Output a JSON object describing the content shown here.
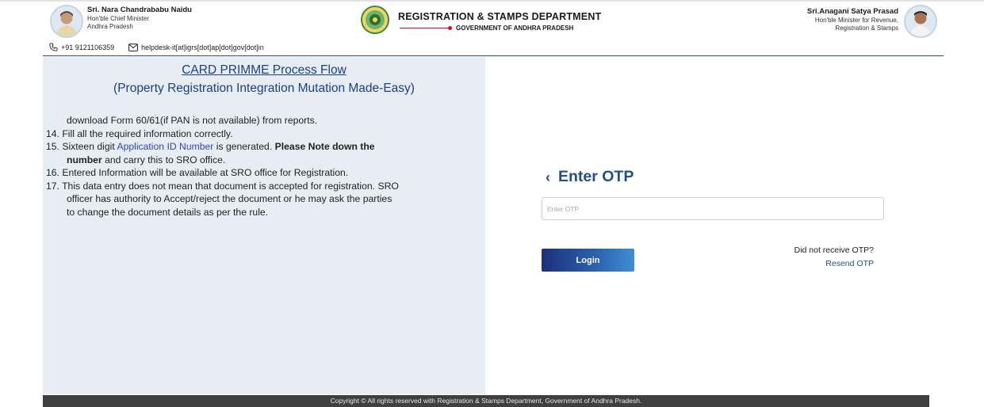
{
  "header": {
    "cm": {
      "name": "Sri. Nara Chandrababu Naidu",
      "title": "Hon'ble Chief Minister",
      "state": "Andhra Pradesh"
    },
    "department": {
      "title": "REGISTRATION & STAMPS DEPARTMENT",
      "government": "GOVERNMENT OF ANDHRA PRADESH"
    },
    "minister": {
      "name": "Sri.Anagani Satya Prasad",
      "title_line1": "Hon'ble Minister for Revenue,",
      "title_line2": "Registration & Stamps"
    },
    "contact": {
      "phone": "+91 9121106359",
      "email": "helpdesk-it[at]igrs[dot]ap[dot]gov[dot]in",
      "phone_icon": "phone-icon",
      "email_icon": "mail-icon"
    }
  },
  "process_flow": {
    "title": "CARD PRIMME Process Flow",
    "subtitle": "(Property Registration Integration Mutation Made-Easy)",
    "lines": {
      "l0": "download Form 60/61(if PAN is not available) from reports.",
      "l14": "14. Fill all the required information correctly.",
      "l15_pre": "15. Sixteen digit ",
      "l15_link": "Application ID Number",
      "l15_mid": " is generated. ",
      "l15_bold": "Please Note down the",
      "l15b_bold": "number",
      "l15b_rest": " and carry this to SRO office.",
      "l16": "16. Entered Information will be available at SRO office for Registration.",
      "l17a": "17. This data entry does not mean that document is accepted for registration. SRO",
      "l17b": "officer has authority to Accept/reject the document or he may ask the parties",
      "l17c": "to change the document details as per the rule."
    }
  },
  "otp": {
    "back_icon": "chevron-left-icon",
    "back_glyph": "‹",
    "title": "Enter OTP",
    "input_placeholder": "Enter OTP",
    "input_value": "",
    "login_label": "Login",
    "resend_question": "Did not receive OTP?",
    "resend_label": "Resend OTP"
  },
  "footer": {
    "text": "Copyright © All rights reserved with Registration & Stamps Department, Government of Andhra Pradesh."
  },
  "colors": {
    "accent": "#1d4f91",
    "link": "#2c47c9",
    "panel_bg": "#e8edf3",
    "footer_bg": "#3f3f3f",
    "rule_red": "#c8102e"
  }
}
